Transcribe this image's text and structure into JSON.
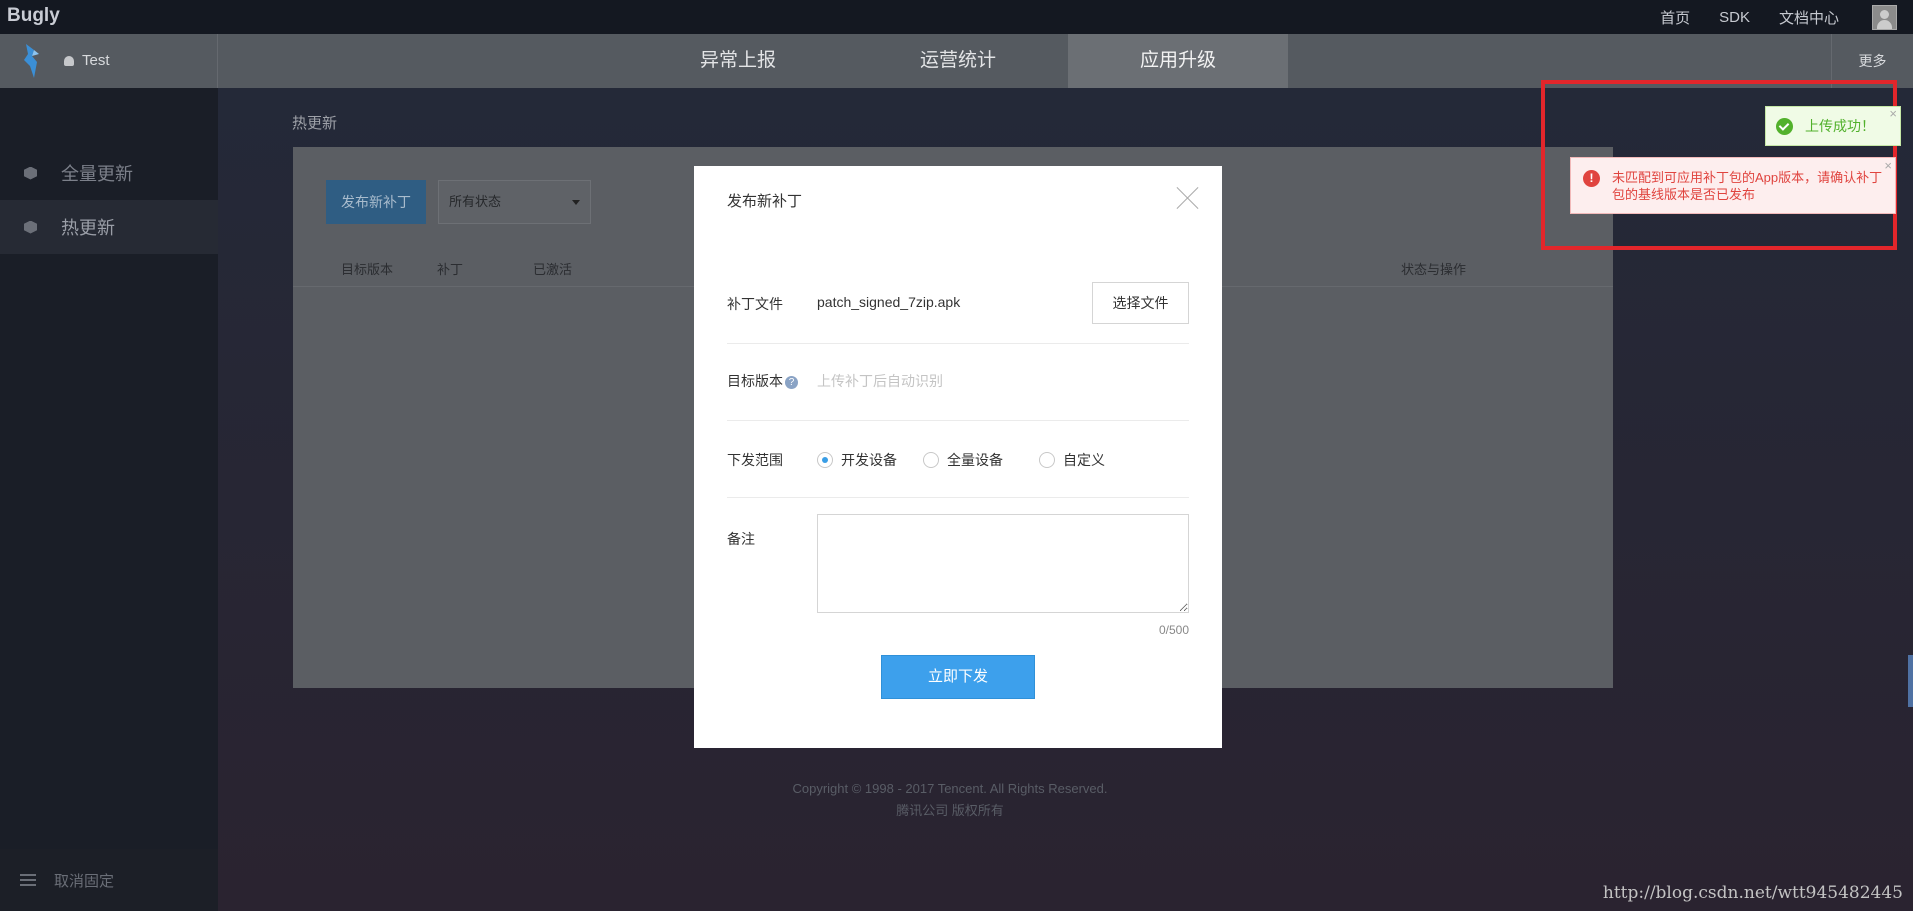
{
  "topbar": {
    "brand": "Bugly",
    "nav": [
      "首页",
      "SDK",
      "文档中心"
    ]
  },
  "appbar": {
    "app_name": "Test",
    "tabs": [
      "异常上报",
      "运营统计",
      "应用升级"
    ],
    "active_tab": "应用升级",
    "more": "更多"
  },
  "sidebar": {
    "items": [
      "全量更新",
      "热更新"
    ],
    "active": "热更新",
    "unpin": "取消固定"
  },
  "main": {
    "breadcrumb": "热更新",
    "new_patch_button": "发布新补丁",
    "status_filter": "所有状态",
    "table_headers": [
      "目标版本",
      "补丁",
      "已激活",
      "状态与操作"
    ]
  },
  "footer": {
    "copyright": "Copyright © 1998 - 2017 Tencent. All Rights Reserved.",
    "company": "腾讯公司 版权所有"
  },
  "modal": {
    "title": "发布新补丁",
    "patch_file_label": "补丁文件",
    "patch_file_value": "patch_signed_7zip.apk",
    "choose_file_button": "选择文件",
    "target_version_label": "目标版本",
    "target_version_placeholder": "上传补丁后自动识别",
    "scope_label": "下发范围",
    "scope_options": [
      "开发设备",
      "全量设备",
      "自定义"
    ],
    "scope_selected": "开发设备",
    "remark_label": "备注",
    "remark_counter": "0/500",
    "submit_button": "立即下发"
  },
  "toasts": {
    "success": "上传成功！",
    "error": "未匹配到可应用补丁包的App版本，请确认补丁包的基线版本是否已发布",
    "close": "×"
  },
  "watermark": "http://blog.csdn.net/wtt945482445",
  "colors": {
    "accent": "#3da0ec",
    "error": "#e0443f",
    "success": "#52b12c",
    "highlight_box": "#e3262b"
  }
}
